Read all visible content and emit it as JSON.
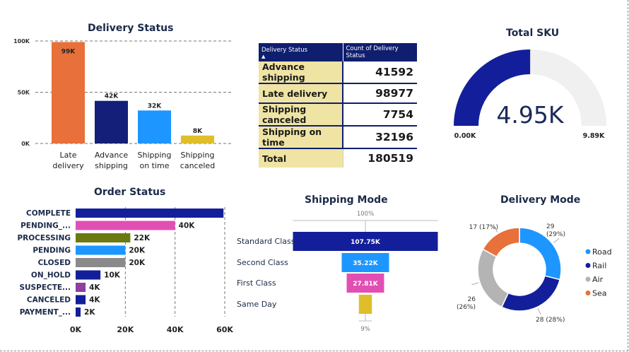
{
  "titles": {
    "delivery_status": "Delivery Status",
    "total_sku": "Total SKU",
    "order_status": "Order Status",
    "shipping_mode": "Shipping Mode",
    "delivery_mode": "Delivery Mode"
  },
  "table": {
    "headers": [
      "Delivery Status",
      "Count of Delivery Status"
    ],
    "rows": [
      {
        "label": "Advance shipping",
        "value": "41592"
      },
      {
        "label": "Late delivery",
        "value": "98977"
      },
      {
        "label": "Shipping canceled",
        "value": "7754"
      },
      {
        "label": "Shipping on time",
        "value": "32196"
      }
    ],
    "total": {
      "label": "Total",
      "value": "180519"
    }
  },
  "chart_data": [
    {
      "id": "delivery_status",
      "type": "bar",
      "title": "Delivery Status",
      "categories": [
        "Late\ndelivery",
        "Advance\nshipping",
        "Shipping\non time",
        "Shipping\ncanceled"
      ],
      "values": [
        98977,
        41592,
        32196,
        7754
      ],
      "data_labels": [
        "99K",
        "42K",
        "32K",
        "8K"
      ],
      "colors": [
        "#e8703a",
        "#131f78",
        "#1e96ff",
        "#e0be2a"
      ],
      "yticks": [
        0,
        50000,
        100000
      ],
      "ytick_labels": [
        "0K",
        "50K",
        "100K"
      ],
      "ylim": [
        0,
        100000
      ],
      "grid": "dashed"
    },
    {
      "id": "total_sku",
      "type": "gauge",
      "title": "Total SKU",
      "value": 4950,
      "min": 0,
      "max": 9890,
      "value_label": "4.95K",
      "min_label": "0.00K",
      "max_label": "9.89K",
      "colors": {
        "fill": "#131f9a",
        "track": "#f0f0f0"
      }
    },
    {
      "id": "order_status",
      "type": "bar",
      "orientation": "horizontal",
      "title": "Order Status",
      "categories": [
        "COMPLETE",
        "PENDING_...",
        "PROCESSING",
        "PENDING",
        "CLOSED",
        "ON_HOLD",
        "SUSPECTE...",
        "CANCELED",
        "PAYMENT_..."
      ],
      "values": [
        59500,
        40000,
        22000,
        20000,
        20000,
        10000,
        4000,
        4000,
        2000
      ],
      "data_labels": [
        "",
        "40K",
        "22K",
        "20K",
        "20K",
        "10K",
        "4K",
        "4K",
        "2K"
      ],
      "colors": [
        "#131f9a",
        "#e14fb4",
        "#6b7a10",
        "#1e96ff",
        "#8a8a8a",
        "#131f9a",
        "#8e3fa0",
        "#131f9a",
        "#131f9a"
      ],
      "xticks": [
        0,
        20000,
        40000,
        60000
      ],
      "xtick_labels": [
        "0K",
        "20K",
        "40K",
        "60K"
      ],
      "xlim": [
        0,
        60000
      ],
      "grid": "dashed"
    },
    {
      "id": "shipping_mode",
      "type": "funnel",
      "title": "Shipping Mode",
      "categories": [
        "Standard Class",
        "Second Class",
        "First Class",
        "Same Day"
      ],
      "values": [
        107750,
        35220,
        27810,
        9700
      ],
      "data_labels": [
        "107.75K",
        "35.22K",
        "27.81K",
        ""
      ],
      "colors": [
        "#131f9a",
        "#1e96ff",
        "#e14fb4",
        "#e0be2a"
      ],
      "top_label": "100%",
      "bottom_label": "9%"
    },
    {
      "id": "delivery_mode",
      "type": "pie",
      "donut": true,
      "title": "Delivery Mode",
      "series": [
        {
          "name": "Road",
          "value": 29,
          "label": "29\n(29%)",
          "color": "#1e96ff"
        },
        {
          "name": "Rail",
          "value": 28,
          "label": "28 (28%)",
          "color": "#131f9a"
        },
        {
          "name": "Air",
          "value": 26,
          "label": "26\n(26%)",
          "color": "#b4b4b4"
        },
        {
          "name": "Sea",
          "value": 17,
          "label": "17 (17%)",
          "color": "#e8703a"
        }
      ],
      "legend": "right"
    }
  ]
}
